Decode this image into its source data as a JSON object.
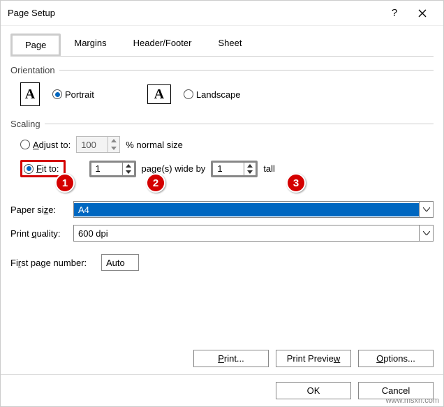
{
  "title": "Page Setup",
  "tabs": [
    "Page",
    "Margins",
    "Header/Footer",
    "Sheet"
  ],
  "orientation": {
    "legend": "Orientation",
    "portrait": "Portrait",
    "landscape": "Landscape",
    "icon_glyph": "A"
  },
  "scaling": {
    "legend": "Scaling",
    "adjust_to": "Adjust to:",
    "adjust_value": "100",
    "normal_size": "% normal size",
    "fit_to": "Fit to:",
    "fit_wide": "1",
    "pages_wide_by": "page(s) wide by",
    "fit_tall": "1",
    "tall": "tall"
  },
  "paper_size": {
    "label": "Paper size:",
    "value": "A4"
  },
  "print_quality": {
    "label": "Print quality:",
    "value": "600 dpi"
  },
  "first_page": {
    "label": "First page number:",
    "value": "Auto"
  },
  "buttons": {
    "print": "Print...",
    "preview": "Print Preview",
    "options": "Options...",
    "ok": "OK",
    "cancel": "Cancel"
  },
  "badges": {
    "b1": "1",
    "b2": "2",
    "b3": "3"
  },
  "watermark": "www.msxn.com"
}
